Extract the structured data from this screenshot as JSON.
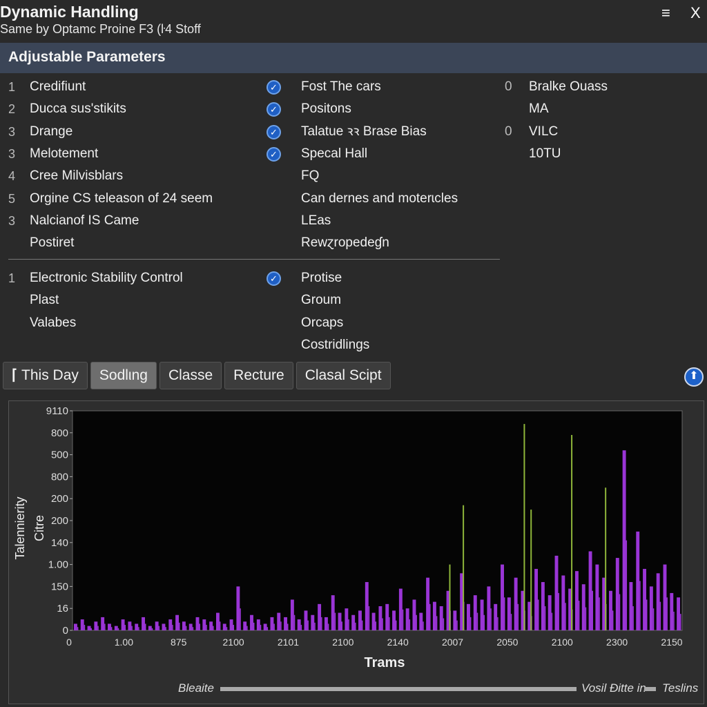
{
  "window": {
    "title": "Dynamic  Handling",
    "subtitle": "Same by Optamc Proine F3 (ŀ4 Stoff",
    "menu_icon": "≡",
    "close_icon": "X"
  },
  "section": {
    "title": "Adjustable Parameters"
  },
  "params": [
    {
      "num": "1",
      "label": "Credifiunt",
      "checked": true,
      "col2": "Fost The cars",
      "num3": "0",
      "col3": "Bralke Ouass"
    },
    {
      "num": "2",
      "label": "Ducca sus'stikits",
      "checked": true,
      "col2": "Positons",
      "num3": "",
      "col3": "MA"
    },
    {
      "num": "3",
      "label": "Drange",
      "checked": true,
      "col2": "Talatue ꝛꝛ Brase Bias",
      "num3": "0",
      "col3": "VILC"
    },
    {
      "num": "3",
      "label": "Melotement",
      "checked": true,
      "col2": "Specal Hall",
      "num3": "",
      "col3": "10TU"
    },
    {
      "num": "4",
      "label": "Cree Milvisblars",
      "checked": false,
      "col2": "FQ",
      "num3": "",
      "col3": ""
    },
    {
      "num": "5",
      "label": "Orgine CS teleason of 24 seem",
      "checked": false,
      "col2": "Can dernes and moterɩcles",
      "num3": "",
      "col3": ""
    },
    {
      "num": "3",
      "label": "Nalcianof IS Came",
      "checked": false,
      "col2": "LEas",
      "num3": "",
      "col3": ""
    },
    {
      "num": "",
      "label": "Postiret",
      "checked": false,
      "col2": "Rewɀropedeɠn",
      "num3": "",
      "col3": ""
    }
  ],
  "params2": [
    {
      "num": "1",
      "label": "Electronic Stability Control",
      "checked": true,
      "col2": "Protise"
    },
    {
      "num": "",
      "label": "Plast",
      "checked": false,
      "col2": "Groum"
    },
    {
      "num": "",
      "label": "Valabes",
      "checked": false,
      "col2": "Orcaps"
    },
    {
      "num": "",
      "label": "",
      "checked": false,
      "col2": "Costridlings"
    }
  ],
  "tabs": [
    {
      "label": "This Day",
      "active": false
    },
    {
      "label": "Sodlιng",
      "active": true
    },
    {
      "label": "Classe",
      "active": false
    },
    {
      "label": "Recture",
      "active": false
    },
    {
      "label": "Clasal Scipt",
      "active": false
    }
  ],
  "chart_data": {
    "type": "bar",
    "ylabel": "Talennierity\nCitre",
    "xlabel": "Trams",
    "y_tick_labels": [
      "0",
      "16",
      "150",
      "1.00",
      "140",
      "200",
      "200",
      "800",
      "500",
      "800",
      "9110"
    ],
    "x_tick_labels": [
      "0",
      "1.00",
      "875",
      "2100",
      "2101",
      "2100",
      "2140",
      "2007",
      "2050",
      "2100",
      "2300",
      "2150"
    ],
    "ylim": [
      0,
      100
    ],
    "grid": false,
    "colors": {
      "purple": "#9a35d6",
      "green": "#8fb63a"
    },
    "series": [
      {
        "color": "purple",
        "values": [
          3,
          5,
          2,
          4,
          6,
          3,
          2,
          5,
          4,
          3,
          6,
          2,
          4,
          3,
          5,
          7,
          4,
          3,
          6,
          5,
          4,
          8,
          3,
          5,
          20,
          4,
          7,
          5,
          3,
          6,
          8,
          6,
          14,
          5,
          9,
          7,
          12,
          6,
          16,
          8,
          10,
          7,
          9,
          22,
          8,
          11,
          12,
          9,
          19,
          10,
          14,
          8,
          24,
          13,
          11,
          18,
          9,
          26,
          12,
          16,
          14,
          20,
          12,
          30,
          15,
          24,
          18,
          13,
          28,
          22,
          16,
          34,
          25,
          19,
          27,
          21,
          36,
          30,
          24,
          18,
          33,
          82,
          22,
          45,
          28,
          20,
          26,
          30,
          17,
          15
        ]
      },
      {
        "color": "green",
        "values": [
          0,
          0,
          0,
          0,
          0,
          0,
          0,
          0,
          0,
          0,
          0,
          0,
          0,
          0,
          0,
          0,
          0,
          0,
          0,
          0,
          0,
          0,
          0,
          0,
          0,
          0,
          0,
          0,
          0,
          0,
          0,
          0,
          0,
          0,
          0,
          0,
          0,
          0,
          0,
          0,
          0,
          0,
          0,
          0,
          0,
          0,
          0,
          0,
          0,
          0,
          0,
          0,
          0,
          0,
          0,
          30,
          0,
          57,
          0,
          0,
          0,
          0,
          0,
          0,
          0,
          0,
          94,
          55,
          0,
          0,
          0,
          0,
          0,
          89,
          0,
          0,
          0,
          0,
          65,
          0,
          0,
          0,
          0,
          0,
          0,
          0,
          0,
          0,
          0,
          0
        ]
      }
    ],
    "legend": {
      "left": "Bleaite",
      "middle": "Vosil Ðitte in",
      "right": "Teslins",
      "slider_value": 1.0
    }
  }
}
